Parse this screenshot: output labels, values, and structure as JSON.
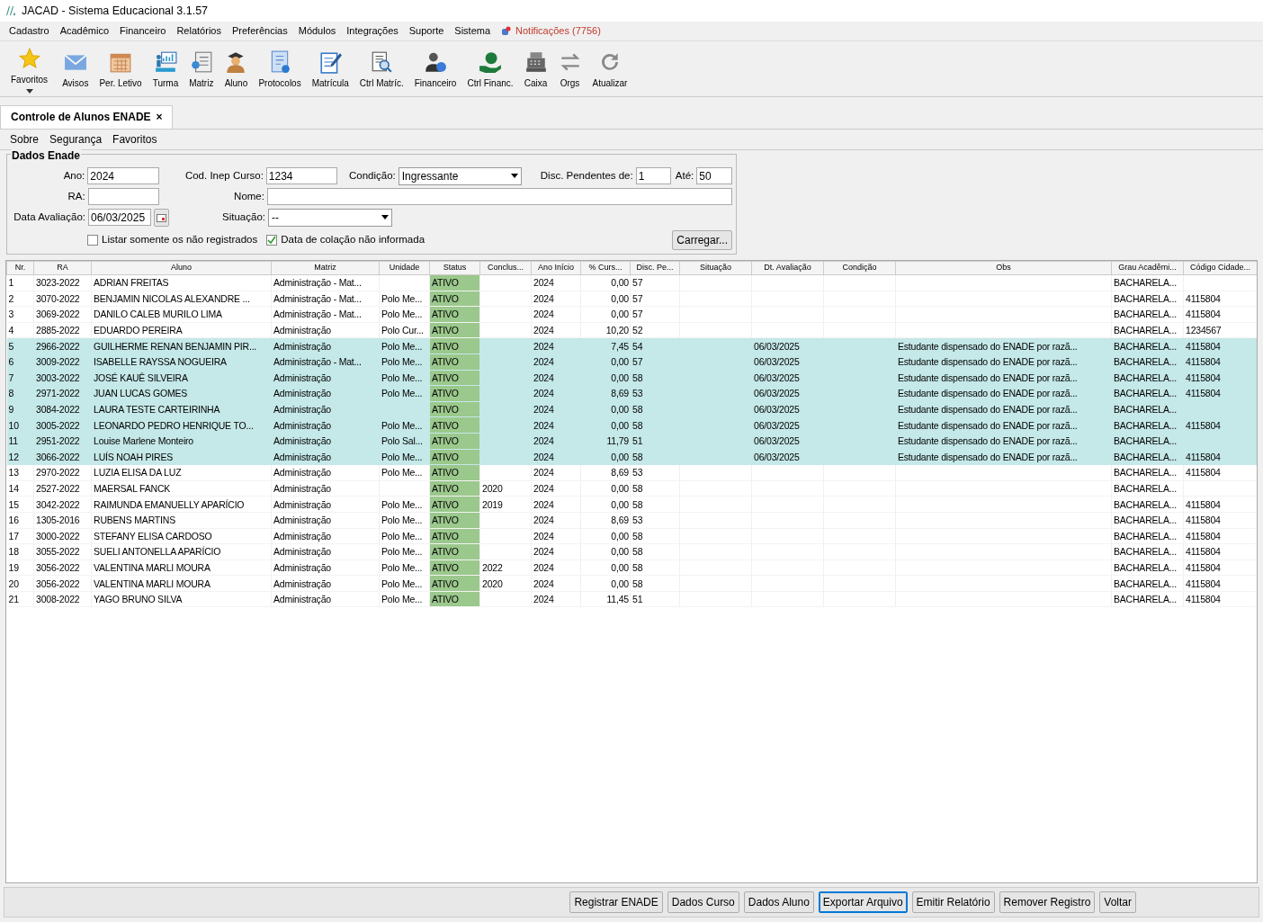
{
  "window": {
    "title": "JACAD - Sistema Educacional 3.1.57"
  },
  "menu": [
    "Cadastro",
    "Acadêmico",
    "Financeiro",
    "Relatórios",
    "Preferências",
    "Módulos",
    "Integrações",
    "Suporte",
    "Sistema"
  ],
  "notifications": "Notificações (7756)",
  "toolbar": [
    "Favoritos",
    "Avisos",
    "Per. Letivo",
    "Turma",
    "Matriz",
    "Aluno",
    "Protocolos",
    "Matrícula",
    "Ctrl Matríc.",
    "Financeiro",
    "Ctrl Financ.",
    "Caixa",
    "Orgs",
    "Atualizar"
  ],
  "tabs": [
    {
      "label": "Controle de Alunos ENADE",
      "selected": true,
      "close": "×"
    }
  ],
  "submenu": [
    "Sobre",
    "Segurança",
    "Favoritos"
  ],
  "form": {
    "legend": "Dados Enade",
    "ano": {
      "label": "Ano:",
      "value": "2024"
    },
    "cod_inep": {
      "label": "Cod. Inep Curso:",
      "value": "1234"
    },
    "condicao": {
      "label": "Condição:",
      "value": "Ingressante"
    },
    "disc_de": {
      "label": "Disc. Pendentes de:",
      "value": "1"
    },
    "ate": {
      "label": "Até:",
      "value": "50"
    },
    "ra": {
      "label": "RA:"
    },
    "nome": {
      "label": "Nome:"
    },
    "data": {
      "label": "Data Avaliação:",
      "value": "06/03/2025"
    },
    "situacao": {
      "label": "Situação:",
      "value": "--"
    },
    "checks": [
      {
        "label": "Listar somente os não registrados",
        "checked": false
      },
      {
        "label": "Data de colação não informada",
        "checked": true
      }
    ],
    "load_button": "Carregar..."
  },
  "table": {
    "columns": [
      "Nr.",
      "RA",
      "Aluno",
      "Matriz",
      "Unidade",
      "Status",
      "Conclus...",
      "Ano Início",
      "% Curs...",
      "Disc. Pe...",
      "Situação",
      "Dt. Avaliação",
      "Condição",
      "Obs",
      "Grau Acadêmi...",
      "Código Cidade..."
    ],
    "rows": [
      {
        "selected": false,
        "cells": [
          "1",
          "3023-2022",
          "ADRIAN FREITAS",
          "Administração - Mat...",
          "",
          "ATIVO",
          "",
          "2024",
          "0,00",
          "57",
          "",
          "",
          "",
          "",
          "BACHARELA...",
          ""
        ]
      },
      {
        "selected": false,
        "cells": [
          "2",
          "3070-2022",
          "BENJAMIN NICOLAS ALEXANDRE ...",
          "Administração - Mat...",
          "Polo Me...",
          "ATIVO",
          "",
          "2024",
          "0,00",
          "57",
          "",
          "",
          "",
          "",
          "BACHARELA...",
          "4115804"
        ]
      },
      {
        "selected": false,
        "cells": [
          "3",
          "3069-2022",
          "DANILO CALEB MURILO LIMA",
          "Administração - Mat...",
          "Polo Me...",
          "ATIVO",
          "",
          "2024",
          "0,00",
          "57",
          "",
          "",
          "",
          "",
          "BACHARELA...",
          "4115804"
        ]
      },
      {
        "selected": false,
        "cells": [
          "4",
          "2885-2022",
          "EDUARDO PEREIRA",
          "Administração",
          "Polo Cur...",
          "ATIVO",
          "",
          "2024",
          "10,20",
          "52",
          "",
          "",
          "",
          "",
          "BACHARELA...",
          "1234567"
        ]
      },
      {
        "selected": true,
        "cells": [
          "5",
          "2966-2022",
          "GUILHERME RENAN BENJAMIN PIR...",
          "Administração",
          "Polo Me...",
          "ATIVO",
          "",
          "2024",
          "7,45",
          "54",
          "",
          "06/03/2025",
          "",
          "Estudante dispensado do ENADE por  razã...",
          "BACHARELA...",
          "4115804"
        ]
      },
      {
        "selected": true,
        "cells": [
          "6",
          "3009-2022",
          "ISABELLE RAYSSA NOGUEIRA",
          "Administração - Mat...",
          "Polo Me...",
          "ATIVO",
          "",
          "2024",
          "0,00",
          "57",
          "",
          "06/03/2025",
          "",
          "Estudante dispensado do ENADE por  razã...",
          "BACHARELA...",
          "4115804"
        ]
      },
      {
        "selected": true,
        "cells": [
          "7",
          "3003-2022",
          "JOSÉ KAUÊ SILVEIRA",
          "Administração",
          "Polo Me...",
          "ATIVO",
          "",
          "2024",
          "0,00",
          "58",
          "",
          "06/03/2025",
          "",
          "Estudante dispensado do ENADE por  razã...",
          "BACHARELA...",
          "4115804"
        ]
      },
      {
        "selected": true,
        "cells": [
          "8",
          "2971-2022",
          "JUAN LUCAS GOMES",
          "Administração",
          "Polo Me...",
          "ATIVO",
          "",
          "2024",
          "8,69",
          "53",
          "",
          "06/03/2025",
          "",
          "Estudante dispensado do ENADE por  razã...",
          "BACHARELA...",
          "4115804"
        ]
      },
      {
        "selected": true,
        "cells": [
          "9",
          "3084-2022",
          "LAURA TESTE CARTEIRINHA",
          "Administração",
          "",
          "ATIVO",
          "",
          "2024",
          "0,00",
          "58",
          "",
          "06/03/2025",
          "",
          "Estudante dispensado do ENADE por  razã...",
          "BACHARELA...",
          ""
        ]
      },
      {
        "selected": true,
        "cells": [
          "10",
          "3005-2022",
          "LEONARDO PEDRO HENRIQUE TO...",
          "Administração",
          "Polo Me...",
          "ATIVO",
          "",
          "2024",
          "0,00",
          "58",
          "",
          "06/03/2025",
          "",
          "Estudante dispensado do ENADE por  razã...",
          "BACHARELA...",
          "4115804"
        ]
      },
      {
        "selected": true,
        "cells": [
          "11",
          "2951-2022",
          "Louise Marlene Monteiro",
          "Administração",
          "Polo Sal...",
          "ATIVO",
          "",
          "2024",
          "11,79",
          "51",
          "",
          "06/03/2025",
          "",
          "Estudante dispensado do ENADE por  razã...",
          "BACHARELA...",
          ""
        ]
      },
      {
        "selected": true,
        "cells": [
          "12",
          "3066-2022",
          "LUÍS NOAH PIRES",
          "Administração",
          "Polo Me...",
          "ATIVO",
          "",
          "2024",
          "0,00",
          "58",
          "",
          "06/03/2025",
          "",
          "Estudante dispensado do ENADE por  razã...",
          "BACHARELA...",
          "4115804"
        ]
      },
      {
        "selected": false,
        "cells": [
          "13",
          "2970-2022",
          "LUZIA ELISA DA LUZ",
          "Administração",
          "Polo Me...",
          "ATIVO",
          "",
          "2024",
          "8,69",
          "53",
          "",
          "",
          "",
          "",
          "BACHARELA...",
          "4115804"
        ]
      },
      {
        "selected": false,
        "cells": [
          "14",
          "2527-2022",
          "MAERSAL FANCK",
          "Administração",
          "",
          "ATIVO",
          "2020",
          "2024",
          "0,00",
          "58",
          "",
          "",
          "",
          "",
          "BACHARELA...",
          ""
        ]
      },
      {
        "selected": false,
        "cells": [
          "15",
          "3042-2022",
          "RAIMUNDA EMANUELLY APARÍCIO",
          "Administração",
          "Polo Me...",
          "ATIVO",
          "2019",
          "2024",
          "0,00",
          "58",
          "",
          "",
          "",
          "",
          "BACHARELA...",
          "4115804"
        ]
      },
      {
        "selected": false,
        "cells": [
          "16",
          "1305-2016",
          "RUBENS MARTINS",
          "Administração",
          "Polo Me...",
          "ATIVO",
          "",
          "2024",
          "8,69",
          "53",
          "",
          "",
          "",
          "",
          "BACHARELA...",
          "4115804"
        ]
      },
      {
        "selected": false,
        "cells": [
          "17",
          "3000-2022",
          "STEFANY ELISA CARDOSO",
          "Administração",
          "Polo Me...",
          "ATIVO",
          "",
          "2024",
          "0,00",
          "58",
          "",
          "",
          "",
          "",
          "BACHARELA...",
          "4115804"
        ]
      },
      {
        "selected": false,
        "cells": [
          "18",
          "3055-2022",
          "SUELI ANTONELLA APARÍCIO",
          "Administração",
          "Polo Me...",
          "ATIVO",
          "",
          "2024",
          "0,00",
          "58",
          "",
          "",
          "",
          "",
          "BACHARELA...",
          "4115804"
        ]
      },
      {
        "selected": false,
        "cells": [
          "19",
          "3056-2022",
          "VALENTINA MARLI MOURA",
          "Administração",
          "Polo Me...",
          "ATIVO",
          "2022",
          "2024",
          "0,00",
          "58",
          "",
          "",
          "",
          "",
          "BACHARELA...",
          "4115804"
        ]
      },
      {
        "selected": false,
        "cells": [
          "20",
          "3056-2022",
          "VALENTINA MARLI MOURA",
          "Administração",
          "Polo Me...",
          "ATIVO",
          "2020",
          "2024",
          "0,00",
          "58",
          "",
          "",
          "",
          "",
          "BACHARELA...",
          "4115804"
        ]
      },
      {
        "selected": false,
        "cells": [
          "21",
          "3008-2022",
          "YAGO BRUNO SILVA",
          "Administração",
          "Polo Me...",
          "ATIVO",
          "",
          "2024",
          "11,45",
          "51",
          "",
          "",
          "",
          "",
          "BACHARELA...",
          "4115804"
        ]
      }
    ]
  },
  "footer_buttons": [
    {
      "label": "Registrar ENADE",
      "focused": false
    },
    {
      "label": "Dados Curso",
      "focused": false
    },
    {
      "label": "Dados Aluno",
      "focused": false
    },
    {
      "label": "Exportar Arquivo",
      "focused": true
    },
    {
      "label": "Emitir Relatório",
      "focused": false
    },
    {
      "label": "Remover Registro",
      "focused": false
    },
    {
      "label": "Voltar",
      "focused": false
    }
  ]
}
